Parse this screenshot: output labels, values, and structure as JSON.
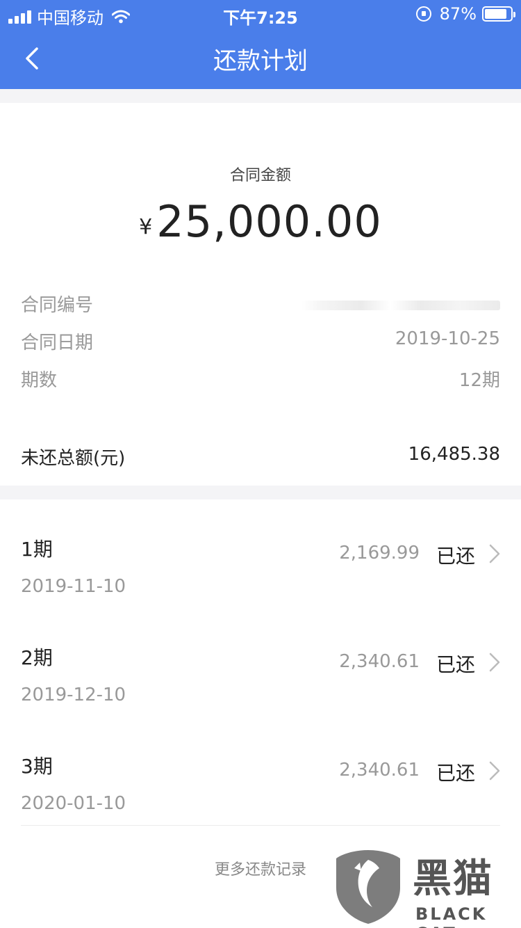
{
  "status_bar": {
    "carrier": "中国移动",
    "time": "下午7:25",
    "battery": "87%",
    "battery_level": 0.87
  },
  "nav": {
    "title": "还款计划",
    "back_icon": "chevron-left-icon"
  },
  "contract": {
    "amount_label": "合同金额",
    "currency_symbol": "¥",
    "amount": "25,000.00",
    "rows": [
      {
        "label": "合同编号",
        "value": ""
      },
      {
        "label": "合同日期",
        "value": "2019-10-25"
      },
      {
        "label": "期数",
        "value": "12期"
      }
    ],
    "owed_label": "未还总额(元)",
    "owed_value": "16,485.38"
  },
  "periods": [
    {
      "name": "1期",
      "date": "2019-11-10",
      "amount": "2,169.99",
      "status": "已还"
    },
    {
      "name": "2期",
      "date": "2019-12-10",
      "amount": "2,340.61",
      "status": "已还"
    },
    {
      "name": "3期",
      "date": "2020-01-10",
      "amount": "2,340.61",
      "status": "已还"
    }
  ],
  "more_link": "更多还款记录",
  "watermark": {
    "text": "黑猫",
    "sub": "BLACK CAT"
  },
  "colors": {
    "accent": "#4a7eea",
    "muted_text": "#999999",
    "primary_text": "#222222"
  }
}
